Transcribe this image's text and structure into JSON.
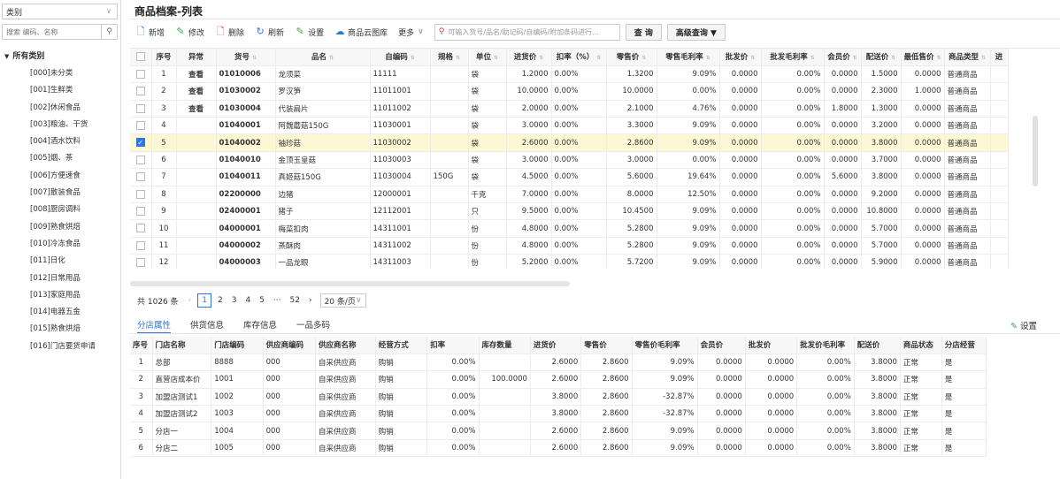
{
  "sidebar": {
    "select_label": "类别",
    "search_placeholder": "搜索 编码、名称",
    "root": "所有类别",
    "items": [
      "[000]未分类",
      "[001]生鲜类",
      "[002]休闲食品",
      "[003]粮油、干货",
      "[004]酒水饮料",
      "[005]烟、茶",
      "[006]方便速食",
      "[007]散装食品",
      "[008]厨房调料",
      "[009]熟食烘焙",
      "[010]冷冻食品",
      "[011]日化",
      "[012]日常用品",
      "[013]家庭用品",
      "[014]电器五金",
      "[015]熟食烘焙",
      "[016]门店要货申请"
    ]
  },
  "page_title": "商品档案-列表",
  "toolbar": {
    "new": "新增",
    "edit": "修改",
    "delete": "删除",
    "refresh": "刷新",
    "settings": "设置",
    "cloud": "商品云图库",
    "more": "更多",
    "search_placeholder": "可输入货号/品名/助记码/自编码/附加条码进行...",
    "query": "查 询",
    "advanced": "高级查询 ▼"
  },
  "grid": {
    "columns": [
      "",
      "序号",
      "异常",
      "货号",
      "品名",
      "自编码",
      "规格",
      "单位",
      "进货价",
      "扣率（%）",
      "零售价",
      "零售毛利率",
      "批发价",
      "批发毛利率",
      "会员价",
      "配送价",
      "最低售价",
      "商品类型",
      "进"
    ],
    "rows": [
      {
        "no": "1",
        "ab": "查看",
        "code": "01010006",
        "name": "龙须菜",
        "self": "11111",
        "spec": "",
        "unit": "袋",
        "buy": "1.2000",
        "disc": "0.00%",
        "retail": "1.3200",
        "rgm": "9.09%",
        "whole": "0.0000",
        "wgm": "0.00%",
        "member": "0.0000",
        "dist": "1.5000",
        "min": "0.0000",
        "type": "普通商品",
        "rgmred": false
      },
      {
        "no": "2",
        "ab": "查看",
        "code": "01030002",
        "name": "罗汉笋",
        "self": "11011001",
        "spec": "",
        "unit": "袋",
        "buy": "10.0000",
        "disc": "0.00%",
        "retail": "10.0000",
        "rgm": "0.00%",
        "whole": "0.0000",
        "wgm": "0.00%",
        "member": "0.0000",
        "dist": "2.3000",
        "min": "1.0000",
        "type": "普通商品",
        "rgmred": true
      },
      {
        "no": "3",
        "ab": "查看",
        "code": "01030004",
        "name": "代装扁片",
        "self": "11011002",
        "spec": "",
        "unit": "袋",
        "buy": "2.0000",
        "disc": "0.00%",
        "retail": "2.1000",
        "rgm": "4.76%",
        "whole": "0.0000",
        "wgm": "0.00%",
        "member": "1.8000",
        "dist": "1.3000",
        "min": "0.0000",
        "type": "普通商品",
        "rgmred": false
      },
      {
        "no": "4",
        "ab": "",
        "code": "01040001",
        "name": "阿魏蘑菇150G",
        "self": "11030001",
        "spec": "",
        "unit": "袋",
        "buy": "3.0000",
        "disc": "0.00%",
        "retail": "3.3000",
        "rgm": "9.09%",
        "whole": "0.0000",
        "wgm": "0.00%",
        "member": "0.0000",
        "dist": "3.2000",
        "min": "0.0000",
        "type": "普通商品",
        "rgmred": false
      },
      {
        "no": "5",
        "ab": "",
        "code": "01040002",
        "name": "袖珍菇",
        "self": "11030002",
        "spec": "",
        "unit": "袋",
        "buy": "2.6000",
        "disc": "0.00%",
        "retail": "2.8600",
        "rgm": "9.09%",
        "whole": "0.0000",
        "wgm": "0.00%",
        "member": "0.0000",
        "dist": "3.8000",
        "min": "0.0000",
        "type": "普通商品",
        "rgmred": false,
        "selected": true
      },
      {
        "no": "6",
        "ab": "",
        "code": "01040010",
        "name": "金顶玉皇菇",
        "self": "11030003",
        "spec": "",
        "unit": "袋",
        "buy": "3.0000",
        "disc": "0.00%",
        "retail": "3.0000",
        "rgm": "0.00%",
        "whole": "0.0000",
        "wgm": "0.00%",
        "member": "0.0000",
        "dist": "3.7000",
        "min": "0.0000",
        "type": "普通商品",
        "rgmred": true
      },
      {
        "no": "7",
        "ab": "",
        "code": "01040011",
        "name": "真姬菇150G",
        "self": "11030004",
        "spec": "150G",
        "unit": "袋",
        "buy": "4.5000",
        "disc": "0.00%",
        "retail": "5.6000",
        "rgm": "19.64%",
        "whole": "0.0000",
        "wgm": "0.00%",
        "member": "5.6000",
        "dist": "3.8000",
        "min": "0.0000",
        "type": "普通商品",
        "rgmred": false
      },
      {
        "no": "8",
        "ab": "",
        "code": "02200000",
        "name": "边猪",
        "self": "12000001",
        "spec": "",
        "unit": "千克",
        "buy": "7.0000",
        "disc": "0.00%",
        "retail": "8.0000",
        "rgm": "12.50%",
        "whole": "0.0000",
        "wgm": "0.00%",
        "member": "0.0000",
        "dist": "9.2000",
        "min": "0.0000",
        "type": "普通商品",
        "rgmred": false
      },
      {
        "no": "9",
        "ab": "",
        "code": "02400001",
        "name": "猪子",
        "self": "12112001",
        "spec": "",
        "unit": "只",
        "buy": "9.5000",
        "disc": "0.00%",
        "retail": "10.4500",
        "rgm": "9.09%",
        "whole": "0.0000",
        "wgm": "0.00%",
        "member": "0.0000",
        "dist": "10.8000",
        "min": "0.0000",
        "type": "普通商品",
        "rgmred": false
      },
      {
        "no": "10",
        "ab": "",
        "code": "04000001",
        "name": "梅菜扣肉",
        "self": "14311001",
        "spec": "",
        "unit": "份",
        "buy": "4.8000",
        "disc": "0.00%",
        "retail": "5.2800",
        "rgm": "9.09%",
        "whole": "0.0000",
        "wgm": "0.00%",
        "member": "0.0000",
        "dist": "5.7000",
        "min": "0.0000",
        "type": "普通商品",
        "rgmred": false
      },
      {
        "no": "11",
        "ab": "",
        "code": "04000002",
        "name": "蒸酥肉",
        "self": "14311002",
        "spec": "",
        "unit": "份",
        "buy": "4.8000",
        "disc": "0.00%",
        "retail": "5.2800",
        "rgm": "9.09%",
        "whole": "0.0000",
        "wgm": "0.00%",
        "member": "0.0000",
        "dist": "5.7000",
        "min": "0.0000",
        "type": "普通商品",
        "rgmred": false
      },
      {
        "no": "12",
        "ab": "",
        "code": "04000003",
        "name": "一品龙眼",
        "self": "14311003",
        "spec": "",
        "unit": "份",
        "buy": "5.2000",
        "disc": "0.00%",
        "retail": "5.7200",
        "rgm": "9.09%",
        "whole": "0.0000",
        "wgm": "0.00%",
        "member": "0.0000",
        "dist": "5.9000",
        "min": "0.0000",
        "type": "普通商品",
        "rgmred": false
      }
    ]
  },
  "pager": {
    "total": "共 1026 条",
    "pages": [
      "1",
      "2",
      "3",
      "4",
      "5",
      "···",
      "52"
    ],
    "prev": "‹",
    "next": "›",
    "size": "20 条/页"
  },
  "tabs": [
    "分店属性",
    "供货信息",
    "库存信息",
    "一品多码"
  ],
  "settings_label": "设置",
  "sub": {
    "columns": [
      "序号",
      "门店名称",
      "门店编码",
      "供应商编码",
      "供应商名称",
      "经营方式",
      "扣率",
      "库存数量",
      "进货价",
      "零售价",
      "零售价毛利率",
      "会员价",
      "批发价",
      "批发价毛利率",
      "配送价",
      "商品状态",
      "分店经营"
    ],
    "rows": [
      [
        "1",
        "总部",
        "8888",
        "000",
        "自采供应商",
        "购销",
        "0.00%",
        "",
        "2.6000",
        "2.8600",
        "9.09%",
        "0.0000",
        "0.0000",
        "0.00%",
        "3.8000",
        "正常",
        "是"
      ],
      [
        "2",
        "直营店成本价",
        "1001",
        "000",
        "自采供应商",
        "购销",
        "0.00%",
        "100.0000",
        "2.6000",
        "2.8600",
        "9.09%",
        "0.0000",
        "0.0000",
        "0.00%",
        "3.8000",
        "正常",
        "是"
      ],
      [
        "3",
        "加盟店测试1",
        "1002",
        "000",
        "自采供应商",
        "购销",
        "0.00%",
        "",
        "3.8000",
        "2.8600",
        "-32.87%",
        "0.0000",
        "0.0000",
        "0.00%",
        "3.8000",
        "正常",
        "是"
      ],
      [
        "4",
        "加盟店测试2",
        "1003",
        "000",
        "自采供应商",
        "购销",
        "0.00%",
        "",
        "3.8000",
        "2.8600",
        "-32.87%",
        "0.0000",
        "0.0000",
        "0.00%",
        "3.8000",
        "正常",
        "是"
      ],
      [
        "5",
        "分店一",
        "1004",
        "000",
        "自采供应商",
        "购销",
        "0.00%",
        "",
        "2.6000",
        "2.8600",
        "9.09%",
        "0.0000",
        "0.0000",
        "0.00%",
        "3.8000",
        "正常",
        "是"
      ],
      [
        "6",
        "分店二",
        "1005",
        "000",
        "自采供应商",
        "购销",
        "0.00%",
        "",
        "2.6000",
        "2.8600",
        "9.09%",
        "0.0000",
        "0.0000",
        "0.00%",
        "3.8000",
        "正常",
        "是"
      ]
    ]
  }
}
